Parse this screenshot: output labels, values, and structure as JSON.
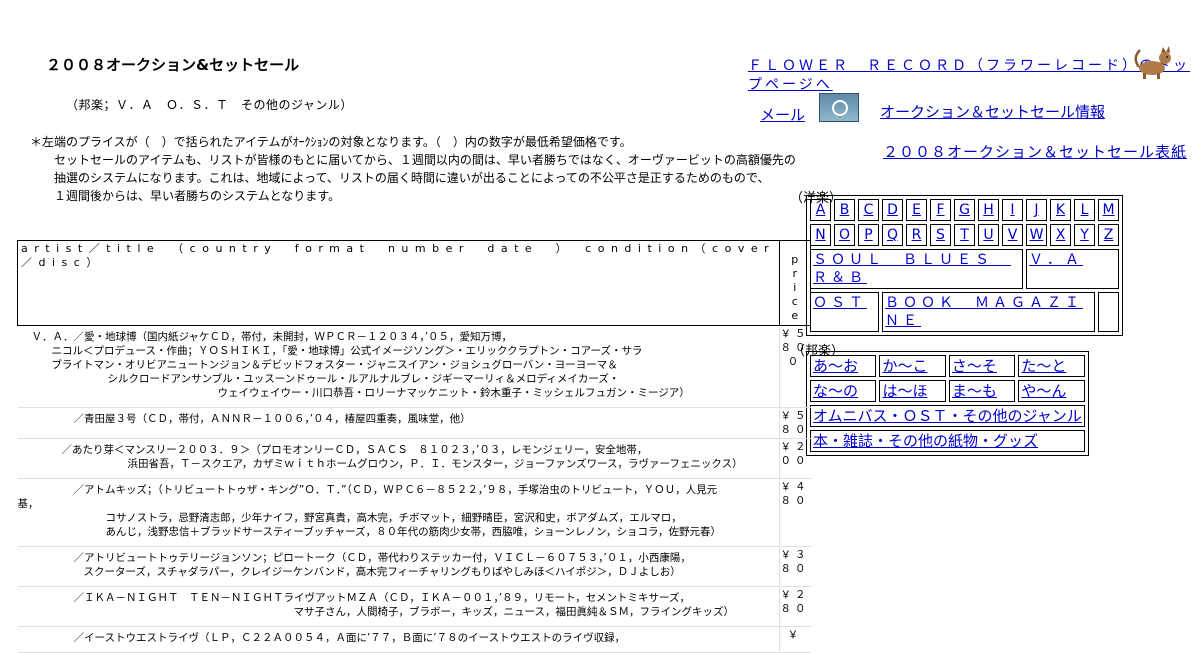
{
  "page": {
    "title": "２００８オークション&セットセール",
    "subtitle": "（邦楽；Ｖ．Ａ　Ｏ．Ｓ．Ｔ　その他のジャンル）",
    "notes": [
      "＊左端のプライスが（　）で括られたアイテムがｵｰｸｼｮﾝの対象となります。（　）内の数字が最低希望価格です。",
      "セットセールのアイテムも、リストが皆様のもとに届いてから、１週間以内の間は、早い者勝ちではなく、オーヴァービットの高額優先の",
      "抽選のシステムになります。これは、地域によって、リストの届く時間に違いが出ることによっての不公平さ是正するためのもので、",
      "１週間後からは、早い者勝ちのシステムとなります。"
    ]
  },
  "header_links": {
    "site": "ＦＬＯＷＥＲ　ＲＥＣＯＲＤ（フラワーレコード）のトップページへ",
    "mail": "メール",
    "info": "オークション＆セットセール情報",
    "table": "２００８オークション＆セットセール表紙"
  },
  "icons": {
    "cat": "cat-illustration-icon",
    "mail": "cd-mail-icon"
  },
  "western": {
    "label": "（洋楽）",
    "row1": [
      "A",
      "B",
      "C",
      "D",
      "E",
      "F",
      "G",
      "H",
      "I",
      "J",
      "K",
      "L",
      "M"
    ],
    "row2": [
      "N",
      "O",
      "P",
      "Q",
      "R",
      "S",
      "T",
      "U",
      "V",
      "W",
      "X",
      "Y",
      "Z"
    ],
    "soul": "ＳＯＵＬ　ＢＬＵＥＳ　Ｒ＆Ｂ",
    "va": "Ｖ．Ａ",
    "ost": "ＯＳＴ",
    "book": "ＢＯＯＫ　ＭＡＧＡＺＩＮＥ"
  },
  "japanese": {
    "label": "（邦楽）",
    "row1": [
      "あ～お",
      "か～こ",
      "さ～そ",
      "た～と"
    ],
    "row2": [
      "な～の",
      "は～ほ",
      "ま～も",
      "や～ん"
    ],
    "omnibus": "オムニバス・ＯＳＴ・その他のジャンル",
    "books": "本・雑誌・その他の紙物・グッズ"
  },
  "list": {
    "header": "artist／title　（country　format　number　date　）　condition（cover／disc）",
    "price_header": "price",
    "items": [
      {
        "lines": [
          "Ｖ．Ａ．／愛・地球博（国内紙ジャケＣＤ，帯付，未開封，ＷＰＣＲ－１２０３４，’０５，愛知万博，",
          "ニコル＜プロデュース・作曲；ＹＯＳＨＩＫＩ，「愛・地球博」公式イメージソング＞・エリッククラプトン・コアーズ・サラ",
          "ブライトマン・オリビアニュートンジョン＆デビッドフォスター・ジャニスイアン・ジョシュグローバン・ヨーヨーマ＆",
          "シルクロードアンサンブル・ユッスーンドゥール・ルアルナルブレ・ジギーマーリィ＆メロディメイカーズ・",
          "ウェイウェイウー・川口恭吾・ロリーナマッケニット・鈴木重子・ミッシェルフュガン・ミージア）"
        ],
        "indents": [
          14,
          34,
          34,
          90,
          200
        ],
        "price": "￥５８００"
      },
      {
        "lines": [
          "／青田屋３号（ＣＤ，帯付，ＡＮＮＲ－１００６，’０４，椿屋四重奏，風味堂，他）"
        ],
        "indents": [
          56
        ],
        "price": "￥５８０"
      },
      {
        "lines": [
          "／あたり芽＜マンスリー２００３．９＞（プロモオンリーＣＤ，ＳＡＣＳ　８１０２３，’０３，レモンジェリー，安全地帯，",
          "浜田省吾，Ｔ－スクエア，カザミｗｉｔｈホームグロウン，Ｐ．Ｉ．モンスター，ジョーファンズワース，ラヴァーフェニックス）"
        ],
        "indents": [
          44,
          110
        ],
        "price": "￥２００"
      },
      {
        "lines": [
          "／アトムキッズ；（トリビュートトゥザ・キング”Ｏ．Ｔ．”（ＣＤ，ＷＰＣ６－８５２２，’９８，手塚治虫のトリビュート，ＹＯＵ，人見元",
          "基，",
          "コサノストラ，忌野清志郎，少年ナイフ，野宮真貴，高木完，チボマット，細野晴臣，宮沢和史，ボアダムズ，エルマロ，",
          "あんじ，浅野忠信＋ブラッドサースティーブッチャーズ，８０年代の筋肉少女帯，西脇唯，ショーンレノン，ショコラ，佐野元春）"
        ],
        "indents": [
          56,
          0,
          88,
          88
        ],
        "price": "￥４８０"
      },
      {
        "lines": [
          "／アトリビュートトゥテリージョンソン；ピロートーク（ＣＤ，帯代わりステッカー付，ＶＩＣＬ－６０７５３，’０１，小西康陽，",
          "スクーターズ，スチャダラパー，クレイジーケンバンド，高木完フィーチャリングもりばやしみほ＜ハイポジ＞，ＤＪよしお）"
        ],
        "indents": [
          56,
          66
        ],
        "price": "￥３８０"
      },
      {
        "lines": [
          "／ＩＫＡ－ＮＩＧＨＴ　ＴＥＮ－ＮＩＧＨＴライヴアットＭＺＡ（ＣＤ，ＩＫＡ－００１，’８９，リモート，セメントミキサーズ，",
          "マサ子さん，人間椅子，ブラボー，キッズ，ニュース，福田眞純＆ＳＭ，フライングキッズ）"
        ],
        "indents": [
          56,
          276
        ],
        "price": "￥２８０"
      },
      {
        "lines": [
          "／イーストウエストライヴ（ＬＰ，Ｃ２２Ａ００５４，Ａ面に’７７，Ｂ面に’７８のイーストウエストのライヴ収録，"
        ],
        "indents": [
          56
        ],
        "price": "￥"
      }
    ]
  }
}
